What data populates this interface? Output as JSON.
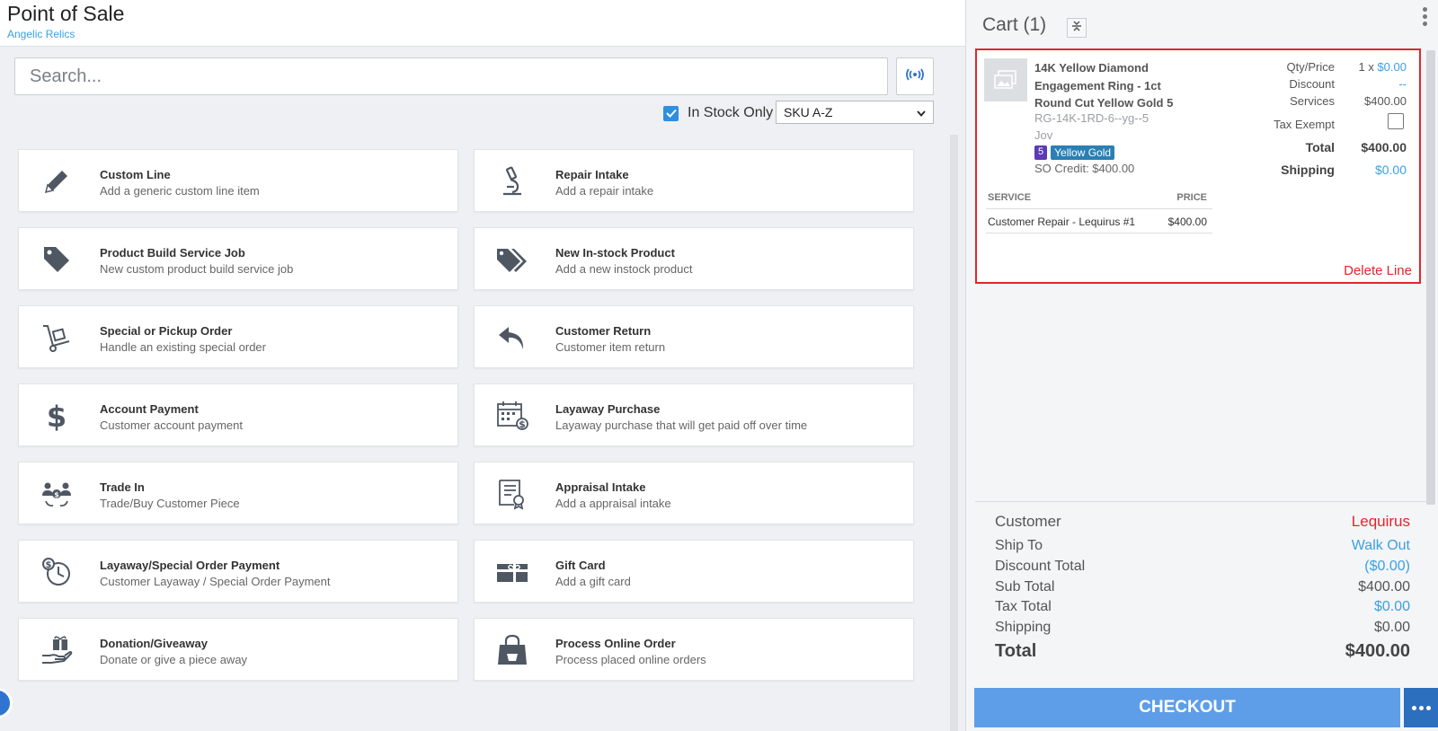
{
  "header": {
    "title": "Point of Sale",
    "subtitle": "Angelic Relics"
  },
  "search": {
    "placeholder": "Search..."
  },
  "filters": {
    "in_stock_label": "In Stock Only",
    "in_stock_checked": true,
    "sort_value": "SKU A-Z"
  },
  "actions": [
    {
      "title": "Custom Line",
      "desc": "Add a generic custom line item",
      "icon": "pencil-icon"
    },
    {
      "title": "Repair Intake",
      "desc": "Add a repair intake",
      "icon": "microscope-icon"
    },
    {
      "title": "Product Build Service Job",
      "desc": "New custom product build service job",
      "icon": "tag-icon"
    },
    {
      "title": "New In-stock Product",
      "desc": "Add a new instock product",
      "icon": "tags-icon"
    },
    {
      "title": "Special or Pickup Order",
      "desc": "Handle an existing special order",
      "icon": "hand-truck-icon"
    },
    {
      "title": "Customer Return",
      "desc": "Customer item return",
      "icon": "undo-arrow-icon"
    },
    {
      "title": "Account Payment",
      "desc": "Customer account payment",
      "icon": "dollar-icon"
    },
    {
      "title": "Layaway Purchase",
      "desc": "Layaway purchase that will get paid off over time",
      "icon": "calendar-dollar-icon"
    },
    {
      "title": "Trade In",
      "desc": "Trade/Buy Customer Piece",
      "icon": "trade-exchange-icon"
    },
    {
      "title": "Appraisal Intake",
      "desc": "Add a appraisal intake",
      "icon": "certificate-icon"
    },
    {
      "title": "Layaway/Special Order Payment",
      "desc": "Customer Layaway / Special Order Payment",
      "icon": "clock-dollar-icon"
    },
    {
      "title": "Gift Card",
      "desc": "Add a gift card",
      "icon": "gift-card-icon"
    },
    {
      "title": "Donation/Giveaway",
      "desc": "Donate or give a piece away",
      "icon": "gift-hand-icon"
    },
    {
      "title": "Process Online Order",
      "desc": "Process placed online orders",
      "icon": "shopping-bag-icon"
    }
  ],
  "cart": {
    "title": "Cart (1)",
    "item": {
      "name": "14K Yellow Diamond Engagement Ring - 1ct Round Cut Yellow Gold 5",
      "sku": "RG-14K-1RD-6--yg--5",
      "vendor": "Jov",
      "size_badge": "5",
      "metal_badge": "Yellow Gold",
      "so_credit": "SO Credit: $400.00",
      "qty_price_label": "Qty/Price",
      "qty": "1 x",
      "price": "$0.00",
      "discount_label": "Discount",
      "discount": "--",
      "services_label": "Services",
      "services": "$400.00",
      "tax_exempt_label": "Tax Exempt",
      "total_label": "Total",
      "total": "$400.00",
      "shipping_label": "Shipping",
      "shipping": "$0.00",
      "service_header": "SERVICE",
      "price_header": "PRICE",
      "service_name": "Customer Repair - Lequirus #1",
      "service_price": "$400.00",
      "delete_label": "Delete Line"
    },
    "summary": {
      "customer_label": "Customer",
      "customer": "Lequirus",
      "ship_to_label": "Ship To",
      "ship_to": "Walk Out",
      "discount_total_label": "Discount Total",
      "discount_total": "($0.00)",
      "sub_total_label": "Sub Total",
      "sub_total": "$400.00",
      "tax_total_label": "Tax Total",
      "tax_total": "$0.00",
      "shipping_label": "Shipping",
      "shipping": "$0.00",
      "total_label": "Total",
      "total": "$400.00"
    },
    "checkout_label": "CHECKOUT"
  },
  "colors": {
    "accent_blue": "#3aa0e4",
    "checkout": "#5e9ee8",
    "danger": "#e0262b",
    "icon": "#4f5763"
  }
}
